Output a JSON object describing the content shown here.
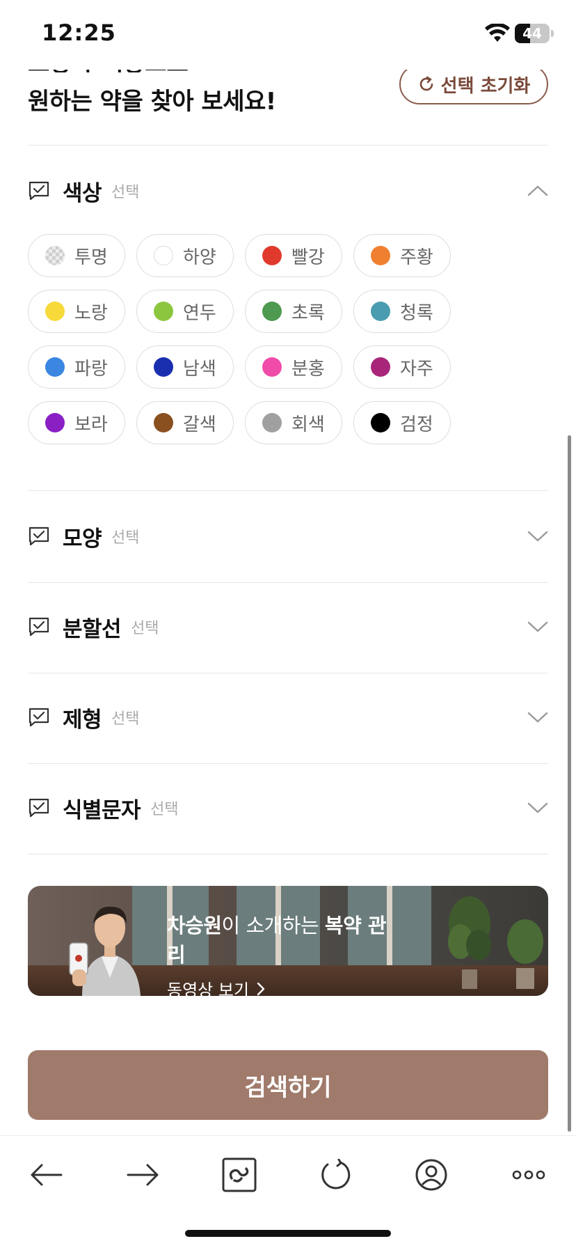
{
  "status_bar": {
    "time": "12:25",
    "battery": "44",
    "battery_level": 0.44
  },
  "header": {
    "clipped_text": "모양과 색상으로",
    "title": "원하는 약을 찾아 보세요!",
    "reset_label": "선택 초기화"
  },
  "sections": {
    "color": {
      "title": "색상",
      "sub": "선택"
    },
    "shape": {
      "title": "모양",
      "sub": "선택"
    },
    "split": {
      "title": "분할선",
      "sub": "선택"
    },
    "form": {
      "title": "제형",
      "sub": "선택"
    },
    "mark": {
      "title": "식별문자",
      "sub": "선택"
    }
  },
  "colors": [
    {
      "label": "투명",
      "hex": "transparent"
    },
    {
      "label": "하양",
      "hex": "#ffffff"
    },
    {
      "label": "빨강",
      "hex": "#e03a2d"
    },
    {
      "label": "주황",
      "hex": "#f08030"
    },
    {
      "label": "노랑",
      "hex": "#f7d93a"
    },
    {
      "label": "연두",
      "hex": "#8cc63f"
    },
    {
      "label": "초록",
      "hex": "#4e9a50"
    },
    {
      "label": "청록",
      "hex": "#4a9cb0"
    },
    {
      "label": "파랑",
      "hex": "#3a86e0"
    },
    {
      "label": "남색",
      "hex": "#1a2fb0"
    },
    {
      "label": "분홍",
      "hex": "#f04ba8"
    },
    {
      "label": "자주",
      "hex": "#a8267a"
    },
    {
      "label": "보라",
      "hex": "#8a1fc4"
    },
    {
      "label": "갈색",
      "hex": "#8a5020"
    },
    {
      "label": "회색",
      "hex": "#a0a0a0"
    },
    {
      "label": "검정",
      "hex": "#000000"
    }
  ],
  "banner": {
    "name": "차승원",
    "middle": "이 소개하는 ",
    "topic": "복약 관리",
    "sub": "동영상 보기"
  },
  "search_label": "검색하기",
  "accent": "#a07a6b"
}
